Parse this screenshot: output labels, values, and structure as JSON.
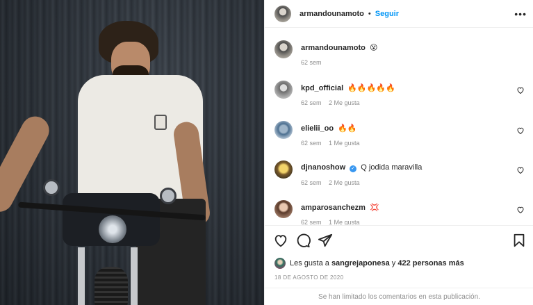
{
  "post": {
    "author": "armandounamoto",
    "follow_label": "Seguir",
    "separator": "•",
    "caption": {
      "username": "armandounamoto",
      "emoji": "😵",
      "time": "62 sem"
    }
  },
  "comments": [
    {
      "username": "kpd_official",
      "text": "🔥🔥🔥🔥🔥",
      "time": "62 sem",
      "likes": "2 Me gusta"
    },
    {
      "username": "elielii_oo",
      "text": "🔥🔥",
      "time": "62 sem",
      "likes": "1 Me gusta"
    },
    {
      "username": "djnanoshow",
      "text": "Q jodida maravilla",
      "time": "62 sem",
      "likes": "2 Me gusta"
    },
    {
      "username": "amparosanchezm",
      "text": "💢",
      "time": "62 sem",
      "likes": "1 Me gusta"
    }
  ],
  "likes": {
    "prefix": "Les gusta a",
    "user": "sangrejaponesa",
    "connector": "y",
    "others": "422 personas más"
  },
  "date": "18 DE AGOSTO DE 2020",
  "footer": "Se han limitado los comentarios en esta publicación.",
  "colors": {
    "link": "#0095f6",
    "muted": "#8e8e8e",
    "text": "#262626",
    "verified": "#3897f0"
  },
  "icons": [
    "more-icon",
    "heart-icon",
    "comment-icon",
    "share-icon",
    "bookmark-icon",
    "verified-icon"
  ]
}
